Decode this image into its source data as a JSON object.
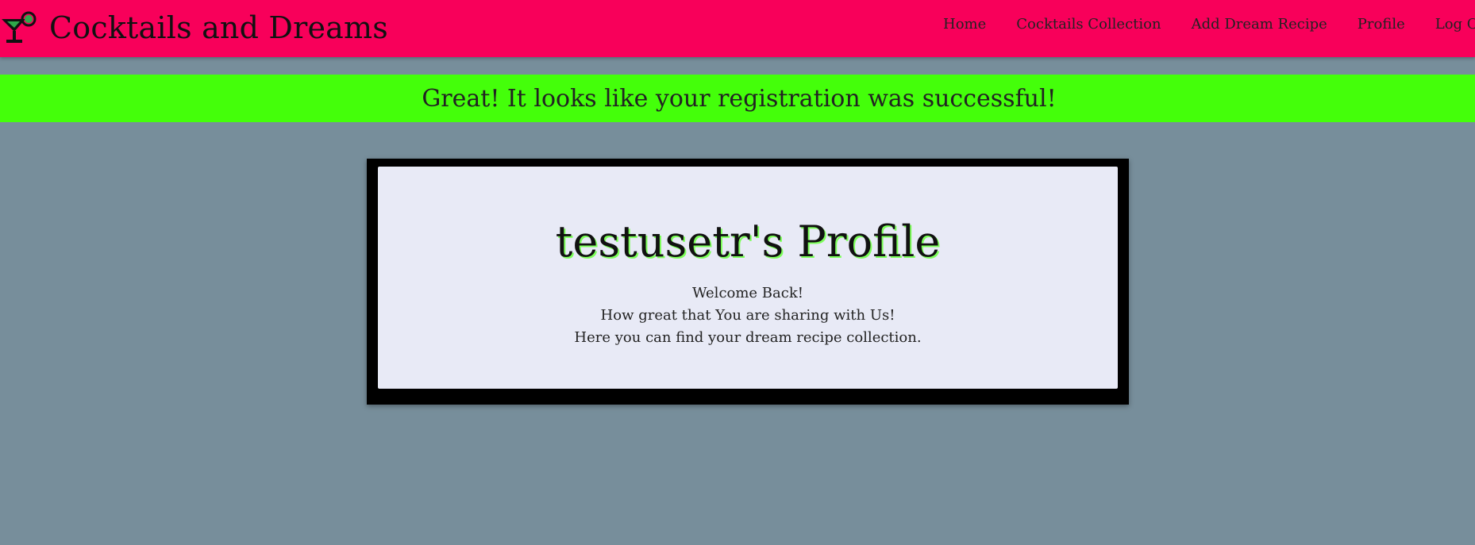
{
  "navbar": {
    "brand_icon": "cocktail-glass-icon",
    "brand_title": "Cocktails and Dreams",
    "links": [
      {
        "label": "Home"
      },
      {
        "label": "Cocktails Collection"
      },
      {
        "label": "Add Dream Recipe"
      },
      {
        "label": "Profile"
      },
      {
        "label": "Log Out"
      }
    ],
    "color": "#f8005a"
  },
  "flash": {
    "message": "Great! It looks like your registration was successful!",
    "color": "#44ff0a"
  },
  "profile": {
    "title": "testusetr's Profile",
    "lines": [
      "Welcome Back!",
      "How great that You are sharing with Us!",
      "Here you can find your dream recipe collection."
    ]
  }
}
